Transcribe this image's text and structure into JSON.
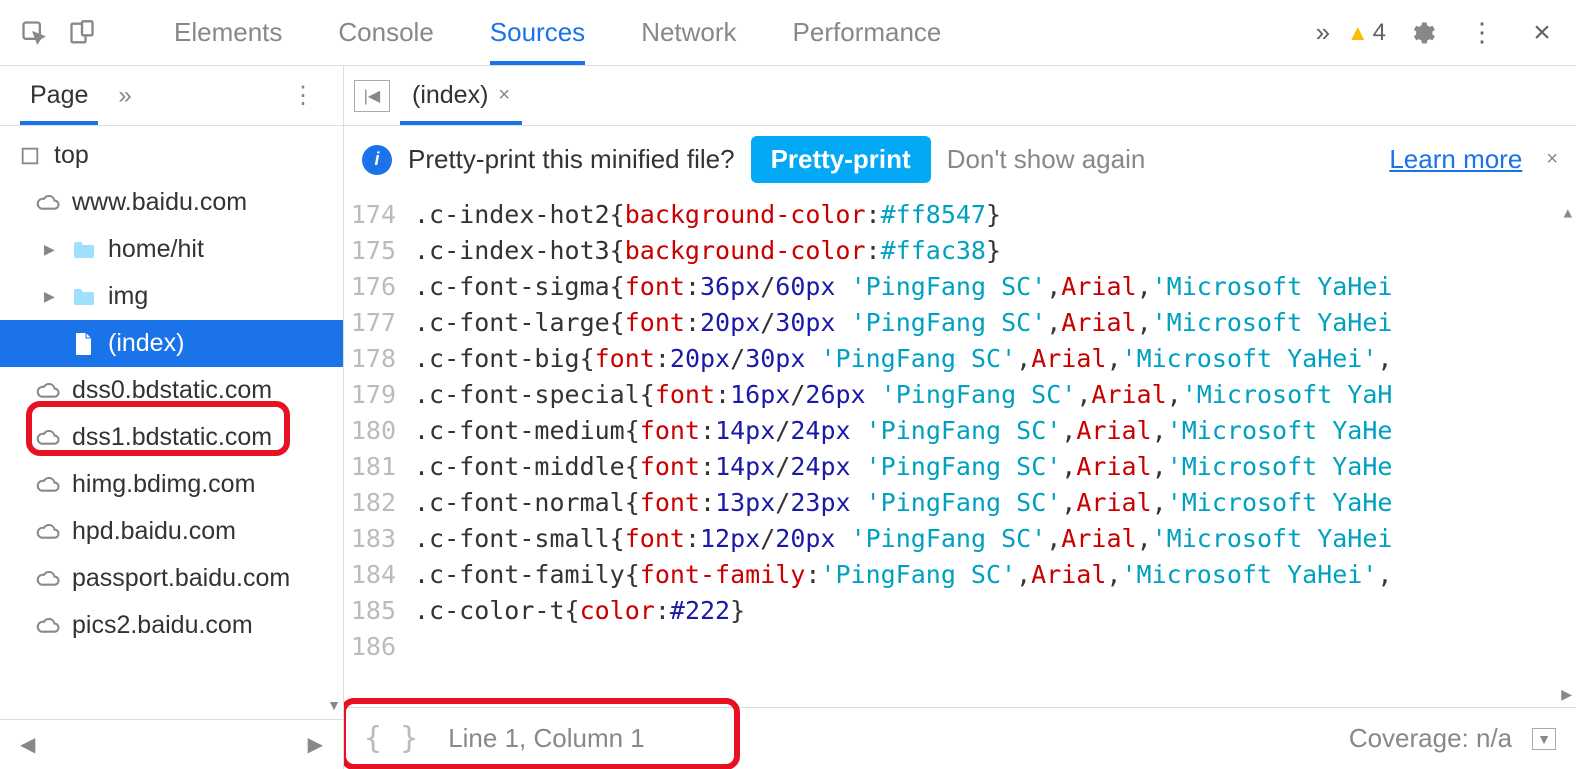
{
  "toolbar": {
    "tabs": [
      "Elements",
      "Console",
      "Sources",
      "Network",
      "Performance"
    ],
    "active_tab": 2,
    "warning_count": "4"
  },
  "sidebar": {
    "tab_label": "Page",
    "tree": [
      {
        "label": "top",
        "icon": "frame",
        "indent": 0
      },
      {
        "label": "www.baidu.com",
        "icon": "cloud",
        "indent": 1
      },
      {
        "label": "home/hit",
        "icon": "folder",
        "indent": 2,
        "toggle": true
      },
      {
        "label": "img",
        "icon": "folder",
        "indent": 2,
        "toggle": true
      },
      {
        "label": "(index)",
        "icon": "file",
        "indent": 2,
        "selected": true
      },
      {
        "label": "dss0.bdstatic.com",
        "icon": "cloud",
        "indent": 1
      },
      {
        "label": "dss1.bdstatic.com",
        "icon": "cloud",
        "indent": 1
      },
      {
        "label": "himg.bdimg.com",
        "icon": "cloud",
        "indent": 1
      },
      {
        "label": "hpd.baidu.com",
        "icon": "cloud",
        "indent": 1
      },
      {
        "label": "passport.baidu.com",
        "icon": "cloud",
        "indent": 1
      },
      {
        "label": "pics2.baidu.com",
        "icon": "cloud",
        "indent": 1
      }
    ]
  },
  "editor": {
    "tab_name": "(index)",
    "info_text": "Pretty-print this minified file?",
    "pretty_btn": "Pretty-print",
    "dont_show": "Don't show again",
    "learn_more": "Learn more",
    "status_line": "Line 1, Column 1",
    "coverage_label": "Coverage: n/a",
    "lines": [
      {
        "n": 174,
        "tokens": [
          [
            ".c-index-hot2{",
            "sel"
          ],
          [
            "background-color",
            "prop"
          ],
          [
            ":",
            "punc"
          ],
          [
            "#ff8547",
            "str"
          ],
          [
            "}",
            "punc"
          ]
        ]
      },
      {
        "n": 175,
        "tokens": [
          [
            ".c-index-hot3{",
            "sel"
          ],
          [
            "background-color",
            "prop"
          ],
          [
            ":",
            "punc"
          ],
          [
            "#ffac38",
            "str"
          ],
          [
            "}",
            "punc"
          ]
        ]
      },
      {
        "n": 176,
        "tokens": [
          [
            ".c-font-sigma{",
            "sel"
          ],
          [
            "font",
            "prop"
          ],
          [
            ":",
            "punc"
          ],
          [
            "36px",
            "val"
          ],
          [
            "/",
            "punc"
          ],
          [
            "60px",
            "val"
          ],
          [
            " ",
            "punc"
          ],
          [
            "'PingFang SC'",
            "str"
          ],
          [
            ",",
            "punc"
          ],
          [
            "Arial",
            "red"
          ],
          [
            ",",
            "punc"
          ],
          [
            "'Microsoft YaHei",
            "str"
          ]
        ]
      },
      {
        "n": 177,
        "tokens": [
          [
            ".c-font-large{",
            "sel"
          ],
          [
            "font",
            "prop"
          ],
          [
            ":",
            "punc"
          ],
          [
            "20px",
            "val"
          ],
          [
            "/",
            "punc"
          ],
          [
            "30px",
            "val"
          ],
          [
            " ",
            "punc"
          ],
          [
            "'PingFang SC'",
            "str"
          ],
          [
            ",",
            "punc"
          ],
          [
            "Arial",
            "red"
          ],
          [
            ",",
            "punc"
          ],
          [
            "'Microsoft YaHei",
            "str"
          ]
        ]
      },
      {
        "n": 178,
        "tokens": [
          [
            ".c-font-big{",
            "sel"
          ],
          [
            "font",
            "prop"
          ],
          [
            ":",
            "punc"
          ],
          [
            "20px",
            "val"
          ],
          [
            "/",
            "punc"
          ],
          [
            "30px",
            "val"
          ],
          [
            " ",
            "punc"
          ],
          [
            "'PingFang SC'",
            "str"
          ],
          [
            ",",
            "punc"
          ],
          [
            "Arial",
            "red"
          ],
          [
            ",",
            "punc"
          ],
          [
            "'Microsoft YaHei'",
            "str"
          ],
          [
            ",",
            "punc"
          ]
        ]
      },
      {
        "n": 179,
        "tokens": [
          [
            ".c-font-special{",
            "sel"
          ],
          [
            "font",
            "prop"
          ],
          [
            ":",
            "punc"
          ],
          [
            "16px",
            "val"
          ],
          [
            "/",
            "punc"
          ],
          [
            "26px",
            "val"
          ],
          [
            " ",
            "punc"
          ],
          [
            "'PingFang SC'",
            "str"
          ],
          [
            ",",
            "punc"
          ],
          [
            "Arial",
            "red"
          ],
          [
            ",",
            "punc"
          ],
          [
            "'Microsoft YaH",
            "str"
          ]
        ]
      },
      {
        "n": 180,
        "tokens": [
          [
            ".c-font-medium{",
            "sel"
          ],
          [
            "font",
            "prop"
          ],
          [
            ":",
            "punc"
          ],
          [
            "14px",
            "val"
          ],
          [
            "/",
            "punc"
          ],
          [
            "24px",
            "val"
          ],
          [
            " ",
            "punc"
          ],
          [
            "'PingFang SC'",
            "str"
          ],
          [
            ",",
            "punc"
          ],
          [
            "Arial",
            "red"
          ],
          [
            ",",
            "punc"
          ],
          [
            "'Microsoft YaHe",
            "str"
          ]
        ]
      },
      {
        "n": 181,
        "tokens": [
          [
            ".c-font-middle{",
            "sel"
          ],
          [
            "font",
            "prop"
          ],
          [
            ":",
            "punc"
          ],
          [
            "14px",
            "val"
          ],
          [
            "/",
            "punc"
          ],
          [
            "24px",
            "val"
          ],
          [
            " ",
            "punc"
          ],
          [
            "'PingFang SC'",
            "str"
          ],
          [
            ",",
            "punc"
          ],
          [
            "Arial",
            "red"
          ],
          [
            ",",
            "punc"
          ],
          [
            "'Microsoft YaHe",
            "str"
          ]
        ]
      },
      {
        "n": 182,
        "tokens": [
          [
            ".c-font-normal{",
            "sel"
          ],
          [
            "font",
            "prop"
          ],
          [
            ":",
            "punc"
          ],
          [
            "13px",
            "val"
          ],
          [
            "/",
            "punc"
          ],
          [
            "23px",
            "val"
          ],
          [
            " ",
            "punc"
          ],
          [
            "'PingFang SC'",
            "str"
          ],
          [
            ",",
            "punc"
          ],
          [
            "Arial",
            "red"
          ],
          [
            ",",
            "punc"
          ],
          [
            "'Microsoft YaHe",
            "str"
          ]
        ]
      },
      {
        "n": 183,
        "tokens": [
          [
            ".c-font-small{",
            "sel"
          ],
          [
            "font",
            "prop"
          ],
          [
            ":",
            "punc"
          ],
          [
            "12px",
            "val"
          ],
          [
            "/",
            "punc"
          ],
          [
            "20px",
            "val"
          ],
          [
            " ",
            "punc"
          ],
          [
            "'PingFang SC'",
            "str"
          ],
          [
            ",",
            "punc"
          ],
          [
            "Arial",
            "red"
          ],
          [
            ",",
            "punc"
          ],
          [
            "'Microsoft YaHei",
            "str"
          ]
        ]
      },
      {
        "n": 184,
        "tokens": [
          [
            ".c-font-family{",
            "sel"
          ],
          [
            "font-family",
            "prop"
          ],
          [
            ":",
            "punc"
          ],
          [
            "'PingFang SC'",
            "str"
          ],
          [
            ",",
            "punc"
          ],
          [
            "Arial",
            "red"
          ],
          [
            ",",
            "punc"
          ],
          [
            "'Microsoft YaHei'",
            "str"
          ],
          [
            ",",
            "punc"
          ]
        ]
      },
      {
        "n": 185,
        "tokens": [
          [
            ".c-color-t{",
            "sel"
          ],
          [
            "color",
            "prop"
          ],
          [
            ":",
            "punc"
          ],
          [
            "#222",
            "val"
          ],
          [
            "}",
            "punc"
          ]
        ]
      },
      {
        "n": 186,
        "tokens": []
      }
    ]
  }
}
